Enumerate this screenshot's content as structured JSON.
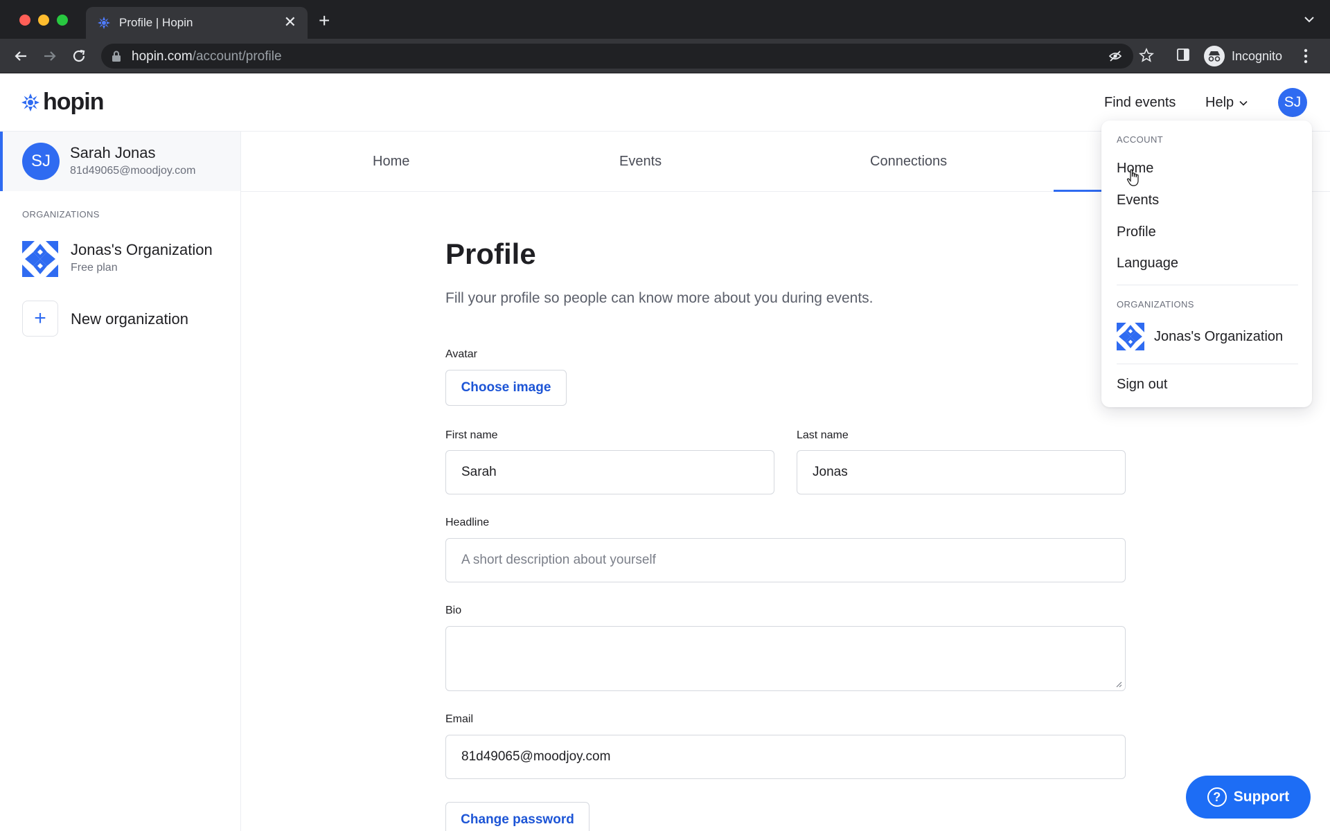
{
  "browser": {
    "tab_title": "Profile | Hopin",
    "close_glyph": "✕",
    "new_tab_glyph": "+",
    "url_host": "hopin.com",
    "url_path": "/account/profile",
    "incognito_label": "Incognito"
  },
  "header": {
    "logo_text": "hopin",
    "find_events": "Find events",
    "help": "Help",
    "avatar_initials": "SJ"
  },
  "sidebar": {
    "user": {
      "initials": "SJ",
      "name": "Sarah Jonas",
      "email": "81d49065@moodjoy.com"
    },
    "organizations_label": "ORGANIZATIONS",
    "organization": {
      "name": "Jonas's Organization",
      "plan": "Free plan"
    },
    "new_org_glyph": "+",
    "new_org_label": "New organization"
  },
  "tabs": {
    "home": "Home",
    "events": "Events",
    "connections": "Connections"
  },
  "form": {
    "title": "Profile",
    "subtitle": "Fill your profile so people can know more about you during events.",
    "avatar_label": "Avatar",
    "choose_image": "Choose image",
    "first_name_label": "First name",
    "first_name_value": "Sarah",
    "last_name_label": "Last name",
    "last_name_value": "Jonas",
    "headline_label": "Headline",
    "headline_placeholder": "A short description about yourself",
    "bio_label": "Bio",
    "email_label": "Email",
    "email_value": "81d49065@moodjoy.com",
    "change_password": "Change password"
  },
  "dropdown": {
    "account_label": "ACCOUNT",
    "items": [
      "Home",
      "Events",
      "Profile",
      "Language"
    ],
    "organizations_label": "ORGANIZATIONS",
    "organization_name": "Jonas's Organization",
    "sign_out": "Sign out"
  },
  "support": {
    "glyph": "?",
    "label": "Support"
  },
  "colors": {
    "brand_blue": "#2f6bf1",
    "support_blue": "#1d6df5",
    "link_blue": "#1d55d6"
  }
}
